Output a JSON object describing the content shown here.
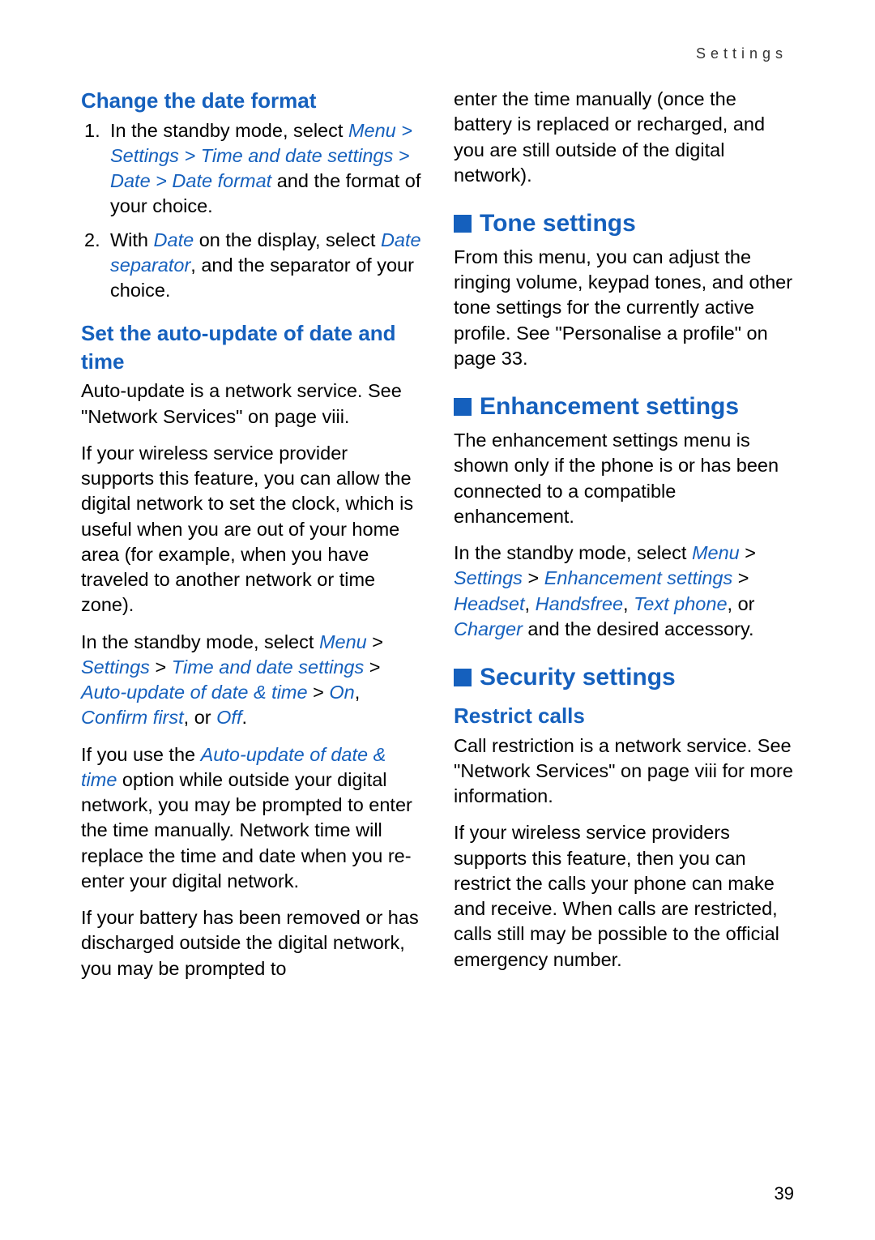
{
  "header": "Settings",
  "pageNumber": "39",
  "left": {
    "h3a": "Change the date format",
    "li1_a": "In the standby mode, select ",
    "li1_nav": "Menu > Settings > Time and date settings > Date > Date format",
    "li1_b": " and the format of your choice.",
    "li2_a": "With ",
    "li2_nav1": "Date",
    "li2_b": " on the display, select ",
    "li2_nav2": "Date separator",
    "li2_c": ", and the separator of your choice.",
    "h3b": "Set the auto-update of date and time",
    "p1": "Auto-update is a network service. See \"Network Services\" on page viii.",
    "p2": "If your wireless service provider supports this feature, you can allow the digital network to set the clock, which is useful when you are out of your home area (for example, when you have traveled to another network or time zone).",
    "p3_a": "In the standby mode, select ",
    "p3_nav1": "Menu",
    "p3_b": " > ",
    "p3_nav2": "Settings",
    "p3_c": " > ",
    "p3_nav3": "Time and date settings",
    "p3_d": " > ",
    "p3_nav4": "Auto-update of date & time",
    "p3_e": " > ",
    "p3_nav5": "On",
    "p3_f": ", ",
    "p3_nav6": "Confirm first",
    "p3_g": ", or ",
    "p3_nav7": "Off",
    "p3_h": ".",
    "p4_a": "If you use the ",
    "p4_nav": "Auto-update of date & time",
    "p4_b": " option while outside your digital network, you may be prompted to enter the time manually. Network time will replace the time and date when you re-enter your digital network.",
    "p5": "If your battery has been removed or has discharged outside the digital network, you may be prompted to"
  },
  "right": {
    "p0": "enter the time manually (once the battery is replaced or recharged, and you are still outside of the digital network).",
    "h2a": "Tone settings",
    "p1": "From this menu, you can adjust the ringing volume, keypad tones, and other tone settings for the currently active profile. See \"Personalise a profile\" on page 33.",
    "h2b": "Enhancement settings",
    "p2": "The enhancement settings menu is shown only if the phone is or has been connected to a compatible enhancement.",
    "p3_a": "In the standby mode, select ",
    "p3_nav1": "Menu",
    "p3_b": " > ",
    "p3_nav2": "Settings",
    "p3_c": " > ",
    "p3_nav3": "Enhancement settings",
    "p3_d": " > ",
    "p3_nav4": "Headset",
    "p3_e": ", ",
    "p3_nav5": "Handsfree",
    "p3_f": ", ",
    "p3_nav6": "Text phone",
    "p3_g": ", or ",
    "p3_nav7": "Charger",
    "p3_h": " and the desired accessory.",
    "h2c": "Security settings",
    "h3a": "Restrict calls",
    "p4": "Call restriction is a network service. See \"Network Services\" on page viii for more information.",
    "p5": "If your wireless service providers supports this feature, then you can restrict the calls your phone can make and receive. When calls are restricted, calls still may be possible to the official emergency number."
  }
}
